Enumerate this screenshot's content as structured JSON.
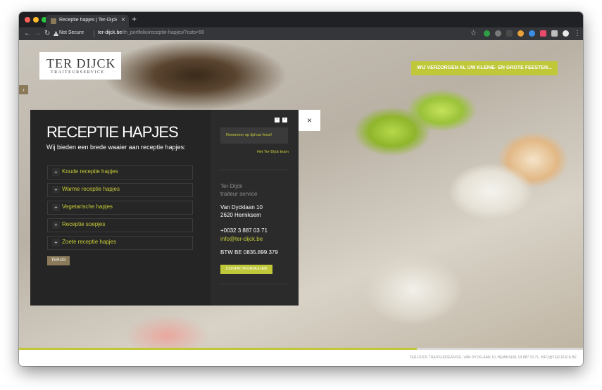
{
  "browser": {
    "tab_title": "Receptie hapjes | Ter-Dijck tra",
    "tab_close": "×",
    "new_tab": "+",
    "security_label": "Not Secure",
    "url_host": "ter-dijck.be",
    "url_path": "/th_portfolio/receptie-hapjes/?cats=90",
    "back_glyph": "←",
    "forward_glyph": "→",
    "reload_glyph": "↻",
    "star_glyph": "☆",
    "menu_glyph": "⋮"
  },
  "site": {
    "logo_title": "TER DIJCK",
    "logo_subtitle": "TRAITEURSERVICE",
    "banner": "WIJ VERZORGEN AL UW KLEINE- EN GROTE FEESTEN...",
    "side_tab_glyph": "›"
  },
  "panel": {
    "title": "RECEPTIE HAPJES",
    "subtitle": "Wij bieden een brede waaier aan receptie hapjes:",
    "items": [
      {
        "label": "Koude receptie hapjes"
      },
      {
        "label": "Warme receptie hapjes"
      },
      {
        "label": "Vegetarische hapjes"
      },
      {
        "label": "Receptie soepjes"
      },
      {
        "label": "Zoete receptie hapjes"
      }
    ],
    "back_button": "TERUG",
    "close_glyph": "×"
  },
  "sidebar": {
    "prev_glyph": "‹",
    "next_glyph": "›",
    "quote": "Reserveer op tijd uw feest!",
    "quote_author": "Het Ter-Dijck team",
    "company_name": "Ter-Dijck",
    "company_type": "traiteur service",
    "street": "Van Dycklaan 10",
    "city": "2620 Hemiksem",
    "phone": "+0032 3 887 03 71",
    "email": "info@ter-dijck.be",
    "vat": "BTW BE 0835.899.379",
    "contact_button": "CONTACTFORMULIER"
  },
  "slideshow": {
    "progress": 0.705
  },
  "footer": {
    "text": "TER-DIJCK TRAITEURSERVICE, VAN DYCKLAAN 10, HEMIKSEM, 03 887 03 71, INFO@TER-DIJCK.BE"
  },
  "colors": {
    "accent_green": "#c0c83a",
    "link_green": "#c8cc38",
    "brand_gold": "#8a7a5a",
    "panel_dark": "#252525"
  }
}
